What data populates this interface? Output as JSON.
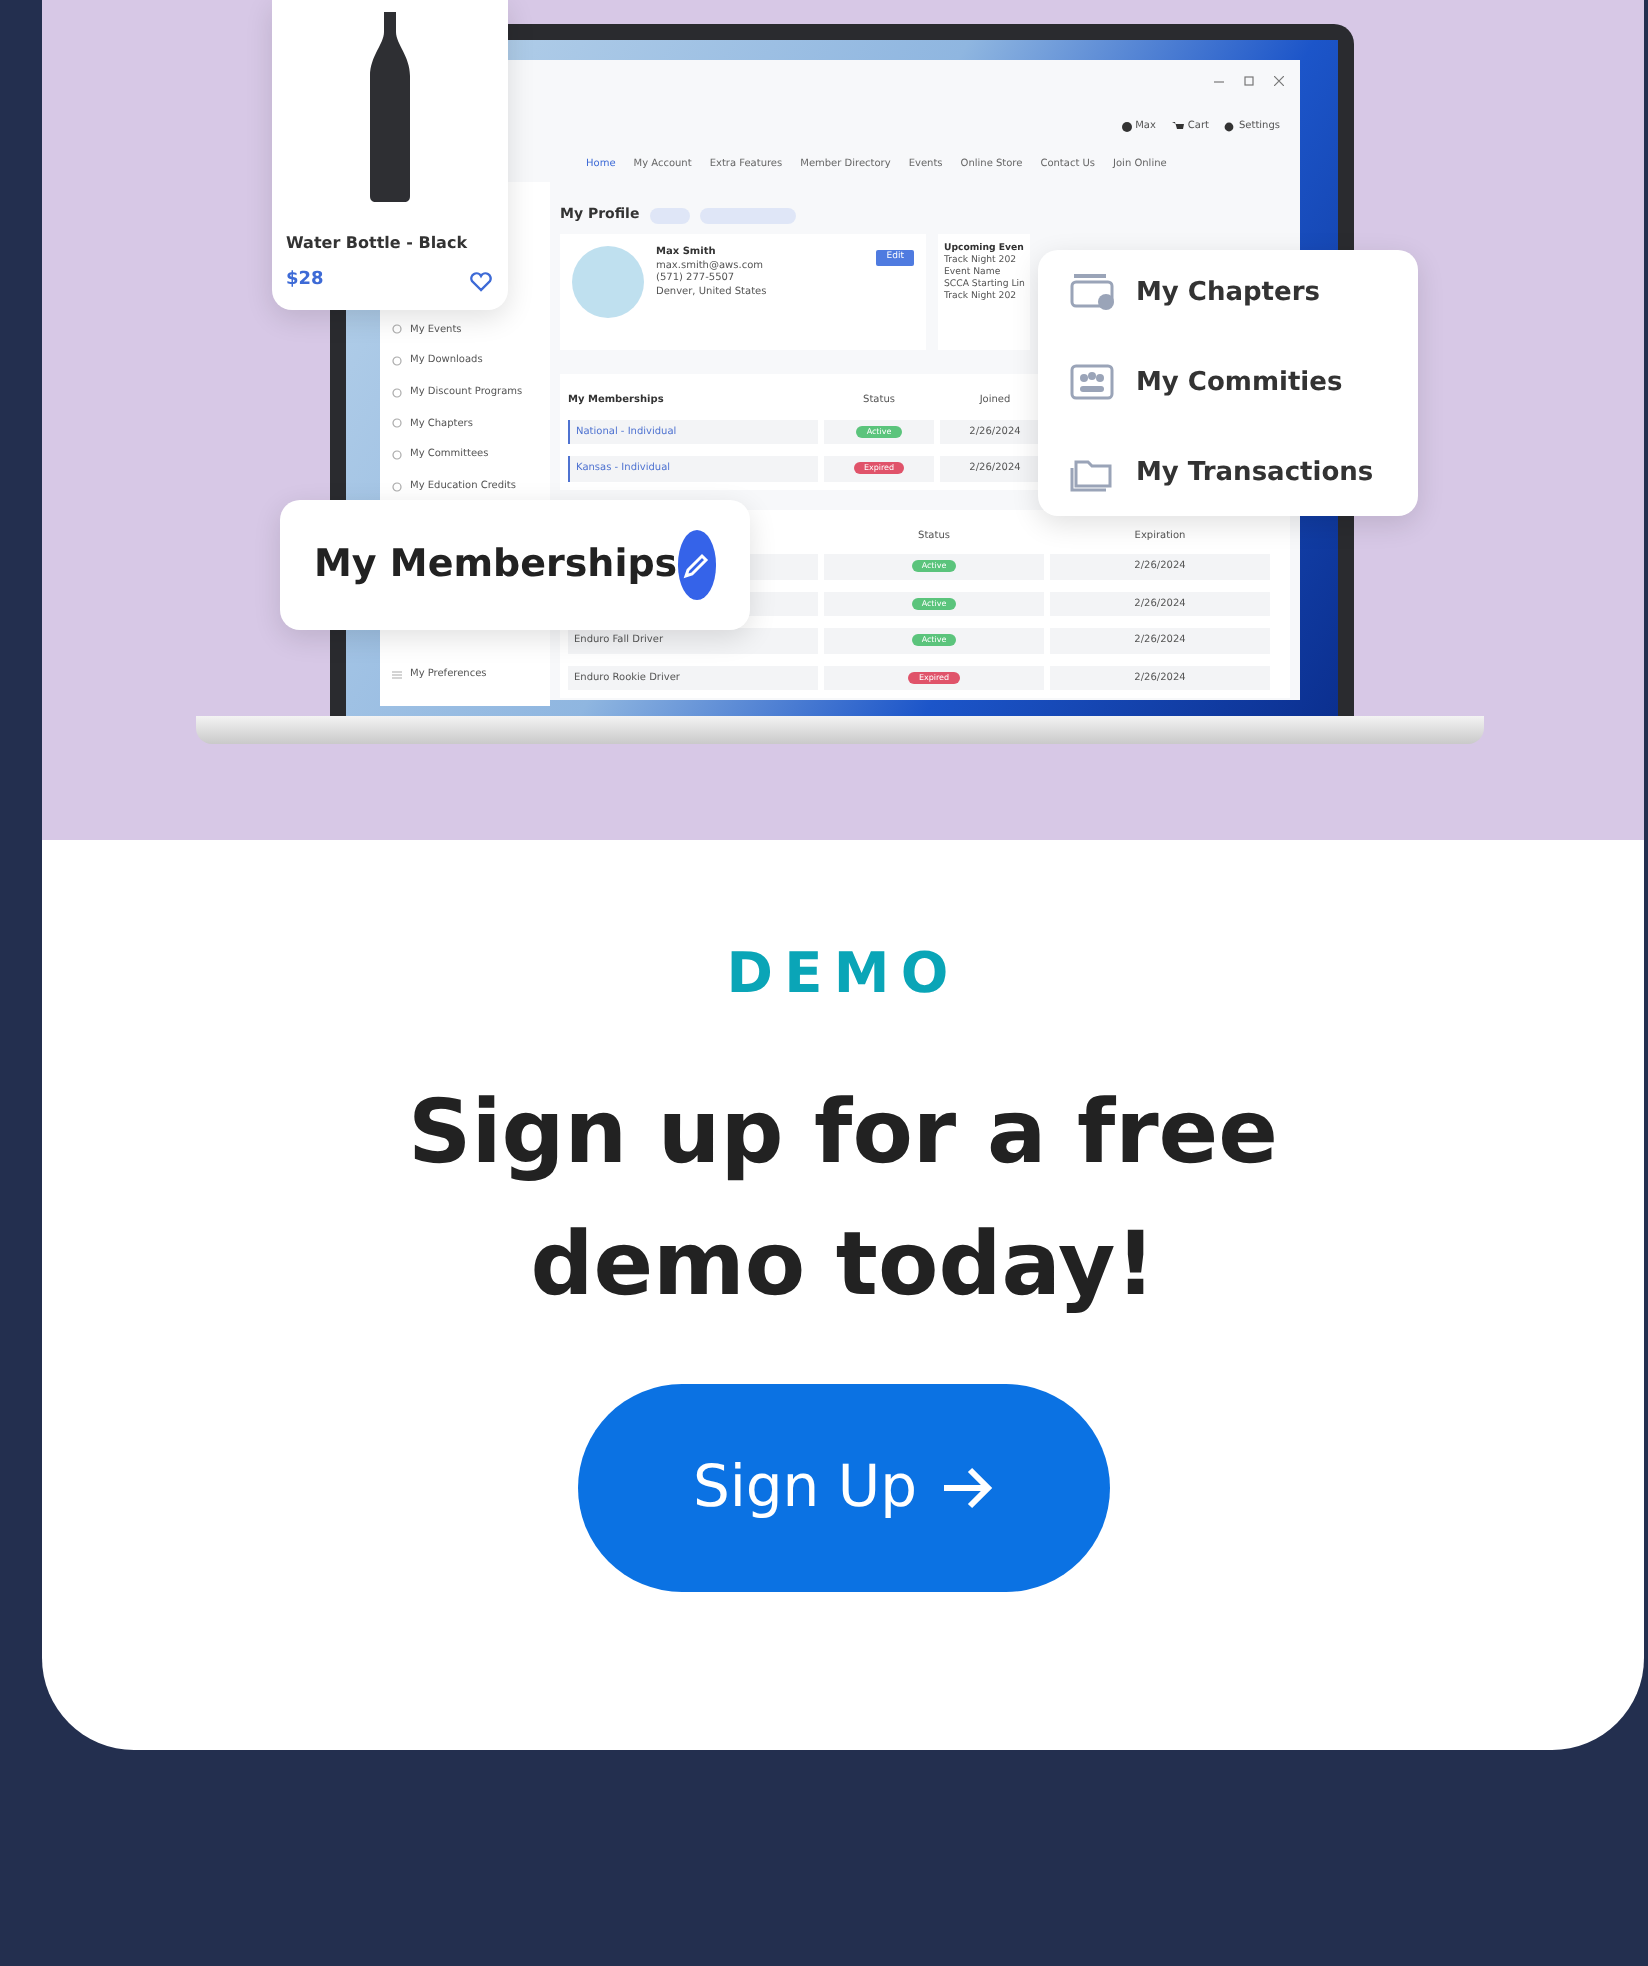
{
  "product_card": {
    "title": "Water Bottle - Black",
    "price": "$28"
  },
  "app_window": {
    "user": "Max",
    "cart": "Cart",
    "settings": "Settings",
    "nav": [
      {
        "label": "Home",
        "selected": true
      },
      {
        "label": "My Account",
        "selected": false
      },
      {
        "label": "Extra Features",
        "selected": false
      },
      {
        "label": "Member Directory",
        "selected": false
      },
      {
        "label": "Events",
        "selected": false
      },
      {
        "label": "Online Store",
        "selected": false
      },
      {
        "label": "Contact Us",
        "selected": false
      },
      {
        "label": "Join Online",
        "selected": false
      }
    ],
    "sidebar": [
      "My Events",
      "My Downloads",
      "My Discount Programs",
      "My Chapters",
      "My Committees",
      "My Education Credits"
    ],
    "sidebar_bottom": [
      "My Preferences"
    ],
    "page_title": "My Profile",
    "profile": {
      "name": "Max Smith",
      "email": "max.smith@aws.com",
      "phone": "(571) 277-5507",
      "location": "Denver, United States",
      "edit": "Edit"
    },
    "upcoming": {
      "title": "Upcoming Even",
      "items": [
        "Track Night 202",
        "Event Name",
        "SCCA Starting Lin",
        "Track Night 202"
      ]
    },
    "memberships": {
      "title": "My Memberships",
      "columns": [
        "Status",
        "Joined"
      ],
      "rows": [
        {
          "name": "National - Individual",
          "status": {
            "label": "Active",
            "kind": "active"
          },
          "date": "2/26/2024"
        },
        {
          "name": "Kansas - Individual",
          "status": {
            "label": "Expired",
            "kind": "expired"
          },
          "date": "2/26/2024"
        }
      ]
    },
    "history": {
      "columns": [
        "Status",
        "Expiration"
      ],
      "rows": [
        {
          "name": "",
          "status": {
            "label": "Active",
            "kind": "active"
          },
          "date": "2/26/2024"
        },
        {
          "name": "",
          "status": {
            "label": "Active",
            "kind": "active"
          },
          "date": "2/26/2024"
        },
        {
          "name": "Enduro Fall Driver",
          "status": {
            "label": "Active",
            "kind": "active"
          },
          "date": "2/26/2024"
        },
        {
          "name": "Enduro Rookie Driver",
          "status": {
            "label": "Expired",
            "kind": "expired"
          },
          "date": "2/26/2024"
        }
      ]
    }
  },
  "memberships_card": {
    "label": "My Memberships"
  },
  "menu_card": [
    {
      "label": "My Chapters",
      "kind": "chapters"
    },
    {
      "label": "My Commities",
      "kind": "committees"
    },
    {
      "label": "My Transactions",
      "kind": "transactions"
    }
  ],
  "demo": {
    "eyebrow": "DEMO",
    "heading": "Sign up for a free demo today!",
    "button": "Sign Up"
  }
}
